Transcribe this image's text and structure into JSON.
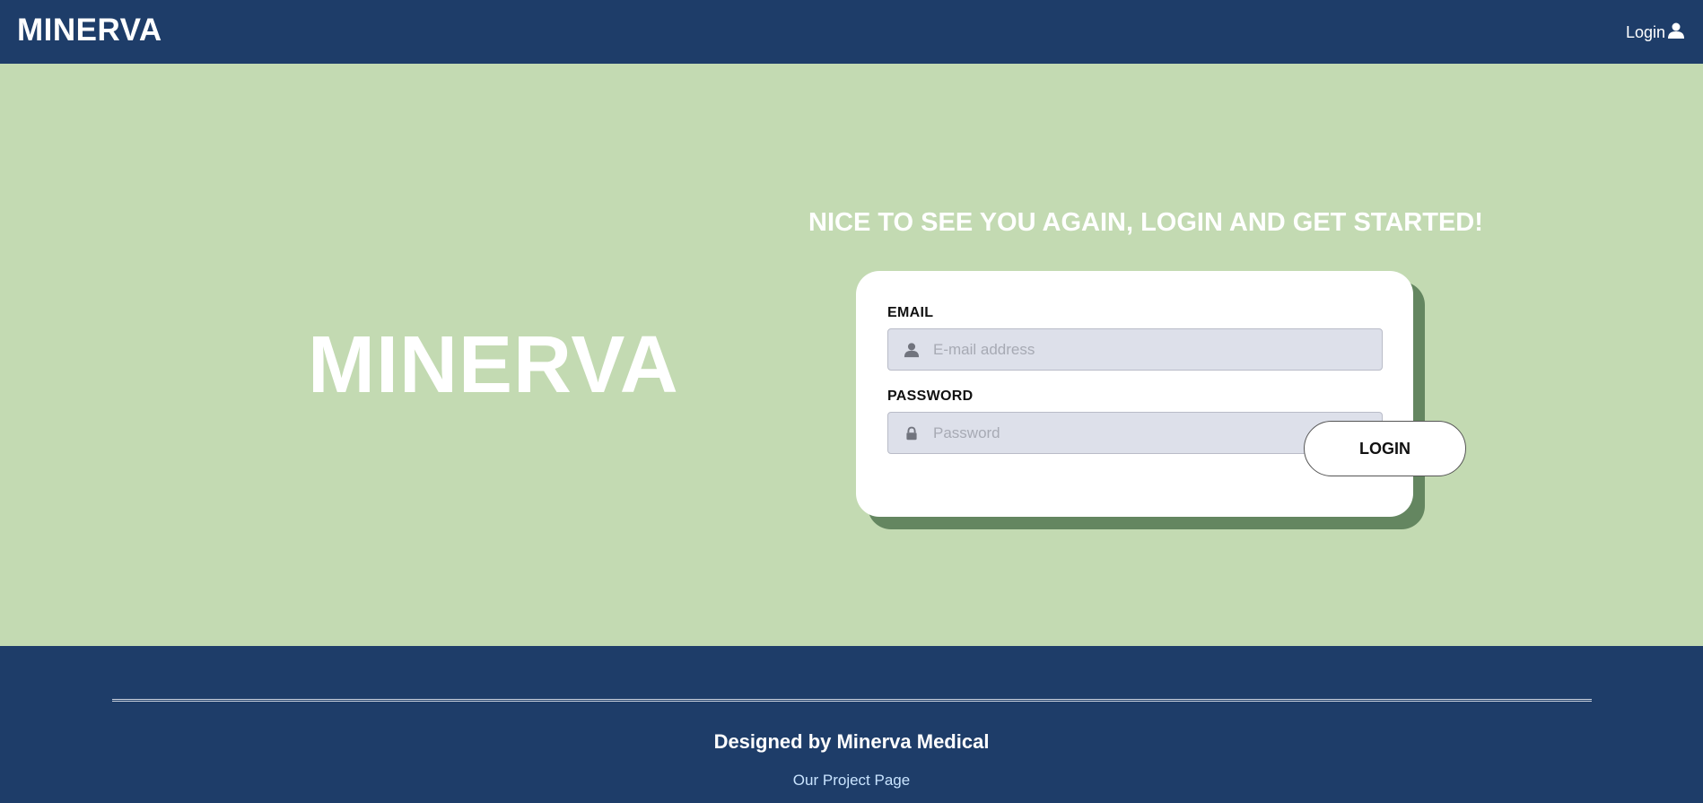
{
  "header": {
    "brand": "MINERVA",
    "login_label": "Login",
    "login_icon": "user-icon"
  },
  "hero": {
    "title": "MINERVA",
    "greeting": "NICE TO SEE YOU AGAIN, LOGIN AND GET STARTED!"
  },
  "form": {
    "email_label": "EMAIL",
    "email_placeholder": "E-mail address",
    "email_value": "",
    "email_icon": "user-icon",
    "password_label": "PASSWORD",
    "password_placeholder": "Password",
    "password_value": "",
    "password_icon": "lock-icon",
    "submit_label": "LOGIN"
  },
  "footer": {
    "credit": "Designed by Minerva Medical",
    "link_label": "Our Project Page"
  },
  "colors": {
    "nav_background": "#1e3d69",
    "hero_background": "#c3dab2",
    "card_shadow": "#648660",
    "input_background": "#dde0ea",
    "footer_link": "#c9e4ff"
  }
}
